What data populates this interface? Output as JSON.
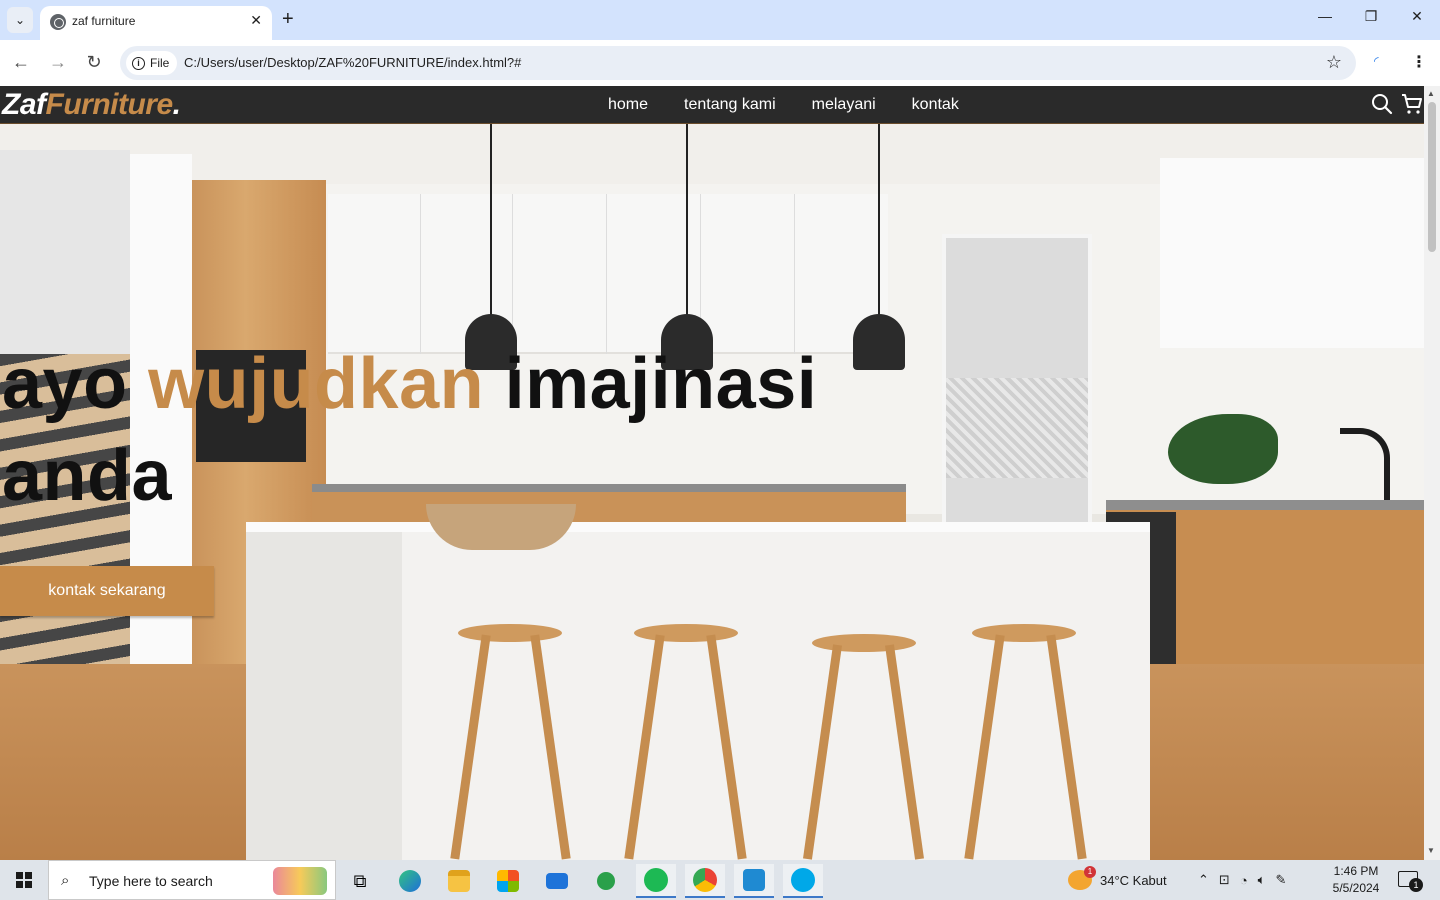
{
  "browser": {
    "tab_title": "zaf furniture",
    "tab_close": "✕",
    "new_tab": "+",
    "url_chip": "File",
    "url": "C:/Users/user/Desktop/ZAF%20FURNITURE/index.html?#",
    "window_controls": {
      "minimize": "—",
      "maximize": "❐",
      "close": "✕"
    }
  },
  "site": {
    "logo_main": "Zaf",
    "logo_accent": "Furniture",
    "logo_dot": ".",
    "nav": [
      "home",
      "tentang kami",
      "melayani",
      "kontak"
    ],
    "icons": [
      "search-icon",
      "shopping-cart-icon"
    ],
    "hero": {
      "line1_word1": "ayo ",
      "line1_accent": "wujudkan",
      "line1_word3": " imajinasi",
      "line2": "anda",
      "cta": "kontak sekarang"
    },
    "colors": {
      "accent": "#c68b4a",
      "navbar": "#2a2a2a"
    }
  },
  "taskbar": {
    "search_placeholder": "Type here to search",
    "apps": [
      "task-view",
      "edge",
      "file-explorer",
      "microsoft-store",
      "mail",
      "game-pass",
      "spotify",
      "chrome",
      "vscode",
      "skype"
    ],
    "weather_badge": "1",
    "weather": "34°C  Kabut",
    "time": "1:46 PM",
    "date": "5/5/2024",
    "notification_count": "1"
  }
}
